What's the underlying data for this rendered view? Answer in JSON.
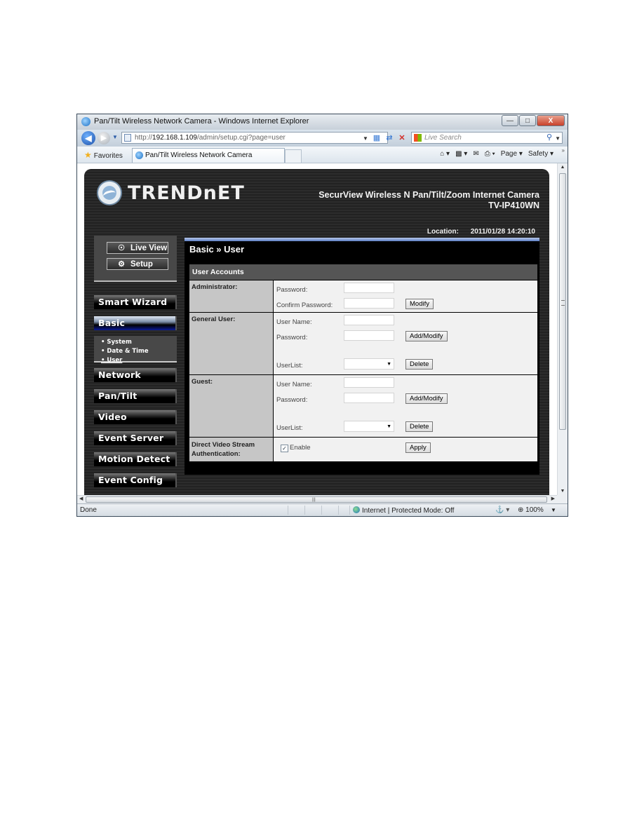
{
  "browser": {
    "window_title": "Pan/Tilt Wireless Network Camera - Windows Internet Explorer",
    "window_buttons": {
      "minimize": "—",
      "maximize": "□",
      "close": "X"
    },
    "address": {
      "prefix": "http://",
      "host": "192.168.1.109",
      "path": "/admin/setup.cgi?page=user"
    },
    "search_placeholder": "Live Search",
    "favorites_label": "Favorites",
    "tab_label": "Pan/Tilt Wireless Network Camera",
    "command_bar": {
      "page_label": "Page ▾",
      "safety_label": "Safety ▾"
    },
    "status": {
      "left": "Done",
      "zone": "Internet | Protected Mode: Off",
      "zoom": "100%"
    }
  },
  "camera_page": {
    "brand": "TRENDnET",
    "product_line1": "SecurView Wireless N Pan/Tilt/Zoom Internet Camera",
    "product_line2": "TV-IP410WN",
    "location_label": "Location:",
    "datetime": "2011/01/28 14:20:10",
    "top_buttons": [
      {
        "label": "Live View",
        "icon": "eye-icon"
      },
      {
        "label": "Setup",
        "icon": "gears-icon"
      }
    ],
    "menu": [
      {
        "label": "Smart Wizard",
        "active": false
      },
      {
        "label": "Basic",
        "active": true
      },
      {
        "label": "Network",
        "active": false
      },
      {
        "label": "Pan/Tilt",
        "active": false
      },
      {
        "label": "Video",
        "active": false
      },
      {
        "label": "Event Server",
        "active": false
      },
      {
        "label": "Motion Detect",
        "active": false
      },
      {
        "label": "Event Config",
        "active": false
      }
    ],
    "submenu": [
      {
        "label": "• System"
      },
      {
        "label": "• Date & Time"
      },
      {
        "label": "• User",
        "current": true
      }
    ],
    "heading": "Basic » User",
    "section_title": "User Accounts",
    "sections": {
      "administrator": {
        "label": "Administrator:",
        "password_label": "Password:",
        "password_value": "",
        "confirm_label": "Confirm Password:",
        "confirm_value": "",
        "button": "Modify"
      },
      "general_user": {
        "label": "General User:",
        "username_label": "User Name:",
        "username_value": "",
        "password_label": "Password:",
        "password_value": "",
        "add_button": "Add/Modify",
        "userlist_label": "UserList:",
        "userlist_selected": "",
        "delete_button": "Delete"
      },
      "guest": {
        "label": "Guest:",
        "username_label": "User Name:",
        "username_value": "",
        "password_label": "Password:",
        "password_value": "",
        "add_button": "Add/Modify",
        "userlist_label": "UserList:",
        "userlist_selected": "",
        "delete_button": "Delete"
      },
      "direct_video": {
        "label_line1": "Direct Video Stream",
        "label_line2": "Authentication:",
        "enable_label": "Enable",
        "enable_checked": true,
        "button": "Apply"
      }
    }
  }
}
